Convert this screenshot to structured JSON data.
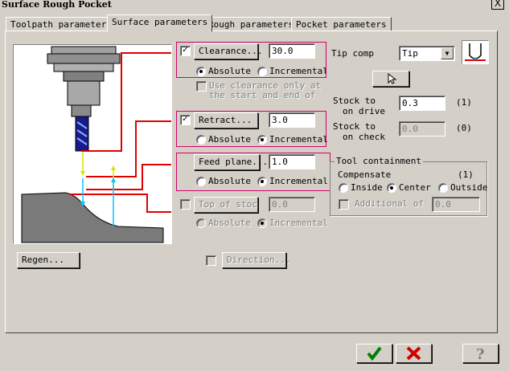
{
  "window": {
    "title": "Surface Rough Pocket",
    "close_glyph": "X"
  },
  "tabs": [
    {
      "label": "Toolpath parameters",
      "active": false
    },
    {
      "label": "Surface parameters",
      "active": true
    },
    {
      "label": "Rough parameters",
      "active": false
    },
    {
      "label": "Pocket parameters",
      "active": false
    }
  ],
  "clearance": {
    "button": "Clearance...",
    "value": "30.0",
    "checked": true,
    "absolute_label": "Absolute",
    "incremental_label": "Incremental",
    "selected": "absolute"
  },
  "use_clearance_text": "Use clearance only at the start and end of",
  "retract": {
    "button": "Retract...",
    "value": "3.0",
    "checked": true,
    "absolute_label": "Absolute",
    "incremental_label": "Incremental",
    "selected": "incremental"
  },
  "feed_plane": {
    "button": "Feed plane...",
    "value": "1.0",
    "absolute_label": "Absolute",
    "incremental_label": "Incremental",
    "selected": "incremental"
  },
  "top_of_stock": {
    "button": "Top of stock...",
    "value": "0.0",
    "checked": false,
    "absolute_label": "Absolute",
    "incremental_label": "Incremental",
    "selected": "incremental"
  },
  "tip_comp": {
    "label": "Tip comp",
    "value": "Tip"
  },
  "stock_drive": {
    "label1": "Stock to",
    "label2": "on drive",
    "value": "0.3",
    "count": "(1)"
  },
  "stock_check": {
    "label1": "Stock to",
    "label2": "on check",
    "value": "0.0",
    "count": "(0)"
  },
  "tool_containment": {
    "title": "Tool containment",
    "compensate_label": "Compensate",
    "count": "(1)",
    "inside_label": "Inside",
    "center_label": "Center",
    "outside_label": "Outside",
    "selected": "center",
    "additional_label": "Additional offset",
    "additional_value": "0.0"
  },
  "regen_button": "Regen...",
  "direction_button": "Direction...",
  "colors": {
    "bg": "#d4d0c8",
    "highlight": "#d4006a",
    "ok": "#008000",
    "cancel": "#d00000"
  }
}
